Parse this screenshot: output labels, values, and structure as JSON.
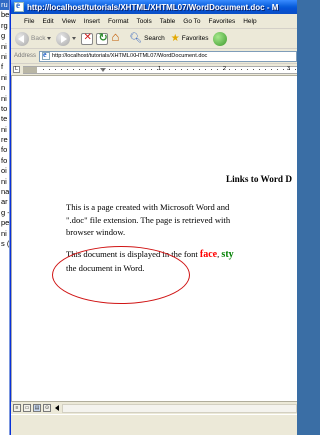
{
  "background_window": {
    "fragments": [
      "ru",
      "be",
      "rg",
      "g",
      "ni",
      "ni",
      "f",
      "ni",
      "n",
      "ni",
      "to",
      "te",
      "ni",
      "re",
      "fo",
      "fo",
      "oi",
      "ni",
      "na",
      "ar",
      "g -",
      "pe",
      "ni",
      "s ("
    ]
  },
  "window": {
    "title": "http://localhost/tutorials/XHTML/XHTML07/WordDocument.doc - M"
  },
  "menubar": {
    "items": [
      "File",
      "Edit",
      "View",
      "Insert",
      "Format",
      "Tools",
      "Table",
      "Go To",
      "Favorites",
      "Help"
    ]
  },
  "toolbar": {
    "back_label": "Back",
    "search_label": "Search",
    "favorites_label": "Favorites"
  },
  "address": {
    "label": "Address",
    "url": "http://localhost/tutorials/XHTML/XHTML07/WordDocument.doc"
  },
  "ruler": {
    "corner": "L",
    "numbers": [
      "1",
      "2",
      "3"
    ]
  },
  "document": {
    "heading": "Links to Word D",
    "para1_lines": [
      "This is a page created with Microsoft Word and",
      "\".doc\" file extension. The page is retrieved with",
      "browser window."
    ],
    "para2_line1_before": "This document is displayed in the font ",
    "para2_face": "face",
    "para2_comma": ", ",
    "para2_sty": "sty",
    "para2_line2": "the document in Word."
  },
  "scrollbar": {
    "view_buttons": [
      "≡",
      "▭",
      "▤",
      "⊙"
    ]
  },
  "colors": {
    "titlebar": "#0a5fdd",
    "face_word": "#ff0000",
    "style_word": "#008000",
    "annotation_ellipse": "#d01515"
  }
}
